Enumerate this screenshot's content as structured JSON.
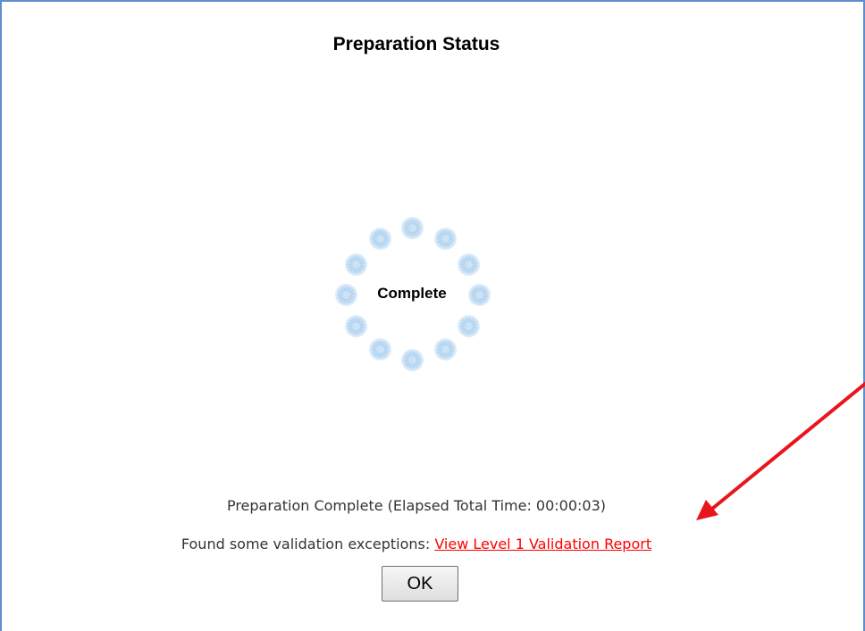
{
  "dialog": {
    "title": "Preparation Status",
    "border_color": "#5b8fd0"
  },
  "spinner": {
    "label": "Complete",
    "icon": "loading-spinner-icon"
  },
  "status": {
    "message": "Preparation Complete (Elapsed Total Time: 00:00:03)"
  },
  "validation": {
    "prefix": "Found some validation exceptions: ",
    "link_text": "View Level 1 Validation Report",
    "link_color": "#ff0000"
  },
  "buttons": {
    "ok_label": "OK"
  },
  "annotation": {
    "icon": "red-arrow-icon",
    "color": "#e8161c"
  }
}
